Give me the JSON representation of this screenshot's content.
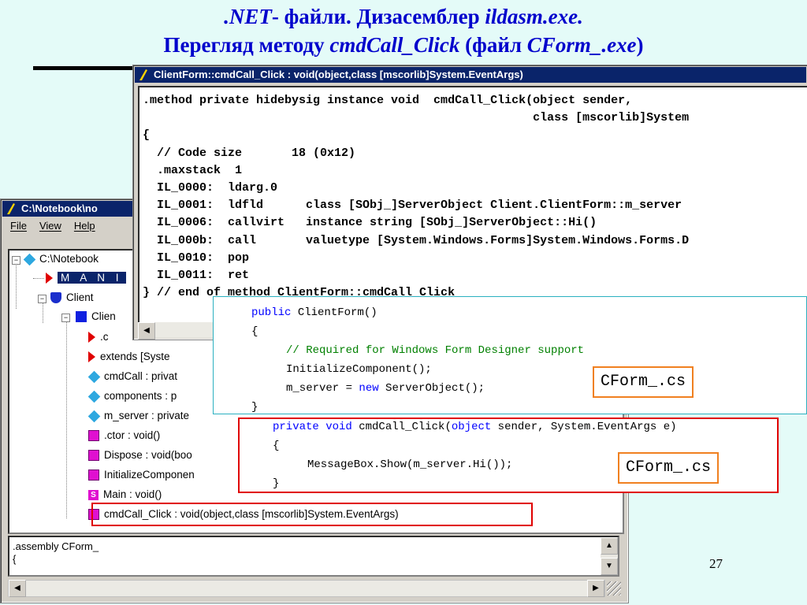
{
  "slide": {
    "title_line1_a": ".NET",
    "title_line1_b": "- файли. Дизасемблер ",
    "title_line1_c": "ildasm.exe.",
    "title_line2_a": "Перегляд методу ",
    "title_line2_b": "cmdCall_Click",
    "title_line2_c": " (файл ",
    "title_line2_d": "CForm_.exe",
    "title_line2_e": ")",
    "page_number": "27",
    "title_color": "#0000cc"
  },
  "ildasm_main": {
    "title": "C:\\Notebook\\no",
    "menu": [
      "File",
      "View",
      "Help"
    ],
    "tree": [
      "C:\\Notebook",
      "M A N I",
      "Client",
      "Clien",
      ".c",
      "extends [Syste",
      "cmdCall : privat",
      "components : p",
      "m_server : private",
      ".ctor : void()",
      "Dispose : void(boo",
      "InitializeComponen",
      "Main : void()",
      "cmdCall_Click : void(object,class [mscorlib]System.EventArgs)"
    ],
    "static_icon_letter": "S",
    "assembly_lines": [
      ".assembly CForm_",
      "{"
    ]
  },
  "il_window": {
    "title": "ClientForm::cmdCall_Click : void(object,class [mscorlib]System.EventArgs)",
    "code": ".method private hidebysig instance void  cmdCall_Click(object sender,\n                                                       class [mscorlib]System\n{\n  // Code size       18 (0x12)\n  .maxstack  1\n  IL_0000:  ldarg.0\n  IL_0001:  ldfld      class [SObj_]ServerObject Client.ClientForm::m_server\n  IL_0006:  callvirt   instance string [SObj_]ServerObject::Hi()\n  IL_000b:  call       valuetype [System.Windows.Forms]System.Windows.Forms.D\n  IL_0010:  pop\n  IL_0011:  ret\n} // end of method ClientForm::cmdCall_Click"
  },
  "cs_snippet1": {
    "kw_public": "public",
    "ctor": " ClientForm()",
    "brace_open": "{",
    "comment": "// Required for Windows Form Designer support",
    "init": "InitializeComponent();",
    "assign_a": "m_server = ",
    "kw_new": "new",
    "assign_b": " ServerObject();",
    "brace_close": "}",
    "label": "CForm_.cs"
  },
  "cs_snippet2": {
    "kw_private": "private",
    "kw_void": "void",
    "method": " cmdCall_Click(",
    "kw_object": "object",
    "params": " sender, System.EventArgs e)",
    "brace_open": "{",
    "body": "MessageBox.Show(m_server.Hi());",
    "brace_close": "}",
    "label": "CForm_.cs"
  }
}
